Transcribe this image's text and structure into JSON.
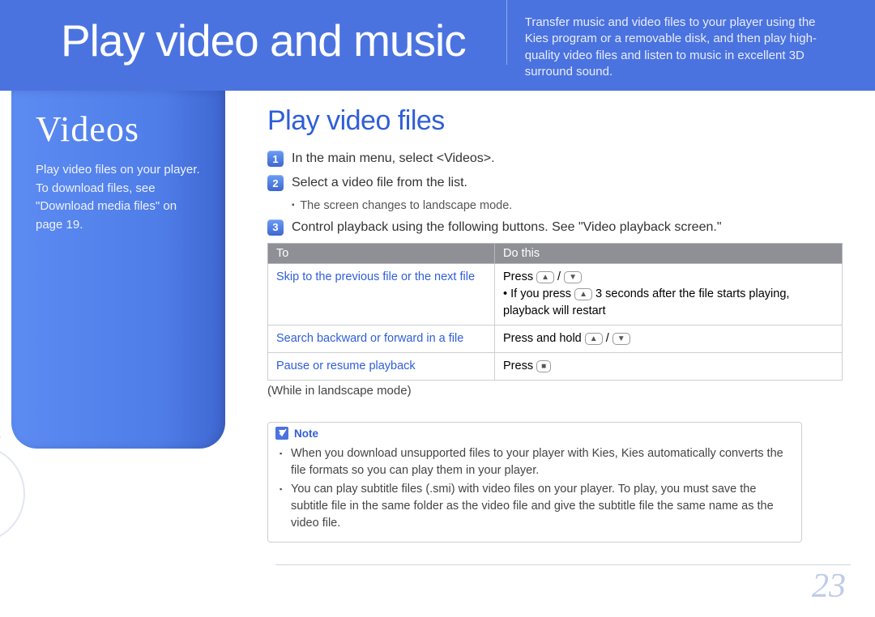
{
  "header": {
    "title": "Play video and music",
    "description": "Transfer music and video files to your player using the Kies program or a removable disk, and then play high-quality video files and listen to music in excellent 3D surround sound."
  },
  "sidebar": {
    "title": "Videos",
    "text": "Play video files on your player.\nTo download files, see \"Download media files\" on page 19."
  },
  "section": {
    "heading": "Play video files",
    "steps": {
      "s1": "In the main menu, select <Videos>.",
      "s2": "Select a video file from the list.",
      "s2_sub": "The screen changes to landscape mode.",
      "s3": "Control playback using the following buttons. See \"Video playback screen.\""
    }
  },
  "table": {
    "head_to": "To",
    "head_do": "Do this",
    "rows": {
      "r1_to": "Skip to the previous file or the next file",
      "r1_do_a": "Press ",
      "r1_do_b": "If you press ",
      "r1_do_c": " 3 seconds after the file starts playing, playback will restart",
      "r2_to": "Search backward or forward in a file",
      "r2_do": "Press and hold ",
      "r3_to": "Pause or resume playback",
      "r3_do": "Press "
    },
    "caption": "(While in landscape mode)"
  },
  "note": {
    "label": "Note",
    "n1": "When you download unsupported files to your player with Kies, Kies automatically converts the file formats so you can play them in your player.",
    "n2": "You can play subtitle files (.smi) with video files on your player. To play, you must save the subtitle file in the same folder as the video file and give the subtitle file the same name as the video file."
  },
  "page_number": "23",
  "icons": {
    "up": "▲",
    "down": "▼",
    "select": "■"
  }
}
